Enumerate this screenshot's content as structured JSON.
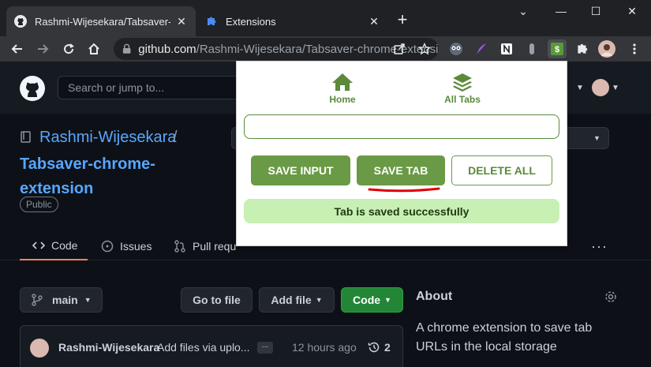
{
  "browser": {
    "tabs": [
      {
        "title": "Rashmi-Wijesekara/Tabsaver-chrome-extension",
        "favicon": "github-icon",
        "active": true
      },
      {
        "title": "Extensions",
        "favicon": "puzzle-icon",
        "active": false
      }
    ],
    "url": {
      "host": "github.com",
      "path": "/Rashmi-Wijesekara/Tabsaver-chrome-extension"
    }
  },
  "github": {
    "search_placeholder": "Search or jump to...",
    "repo": {
      "owner": "Rashmi-Wijesekara",
      "separator": "/",
      "name": "Tabsaver-chrome-extension",
      "visibility": "Public"
    },
    "tabs": [
      {
        "label": "Code",
        "active": true
      },
      {
        "label": "Issues",
        "active": false
      },
      {
        "label": "Pull requ",
        "active": false
      }
    ],
    "branch": "main",
    "buttons": {
      "go_to_file": "Go to file",
      "add_file": "Add file",
      "code": "Code"
    },
    "commit": {
      "author": "Rashmi-Wijesekara",
      "message": "Add files via uplo...",
      "more": "...",
      "time": "12 hours ago",
      "count": "2"
    },
    "about": {
      "title": "About",
      "description": "A chrome extension to save tab URLs in the local storage"
    }
  },
  "popup": {
    "nav": [
      {
        "label": "Home",
        "icon": "home-icon"
      },
      {
        "label": "All Tabs",
        "icon": "layers-icon"
      }
    ],
    "input_value": "",
    "buttons": {
      "save_input": "SAVE INPUT",
      "save_tab": "SAVE TAB",
      "delete_all": "DELETE ALL"
    },
    "status": "Tab is saved successfully",
    "colors": {
      "primary": "#6a9a45",
      "status_bg": "#c8efb4",
      "annotation": "#e00000"
    }
  }
}
